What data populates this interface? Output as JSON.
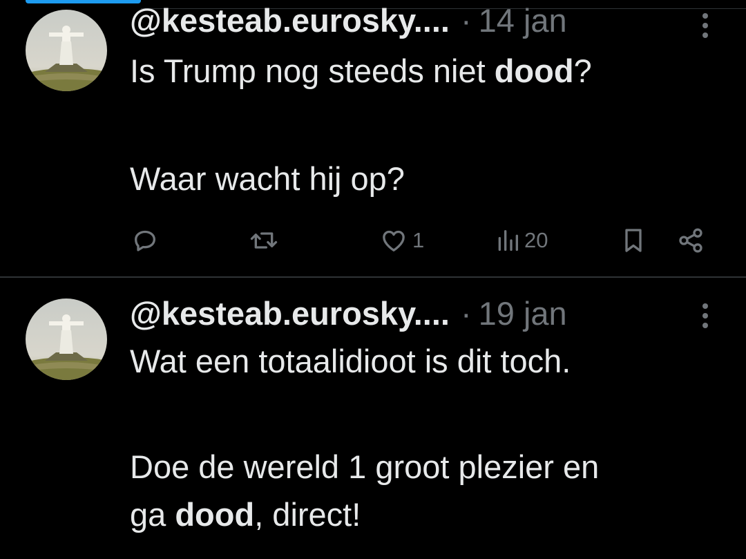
{
  "tweets": [
    {
      "handle": "@kesteab.eurosky....",
      "separator": "·",
      "date": "14 jan",
      "body": {
        "line1_pre": "Is Trump nog steeds niet ",
        "line1_bold": "dood",
        "line1_post": "?",
        "line2": "Waar wacht hij op?"
      },
      "stats": {
        "replies": "",
        "retweets": "",
        "likes": "1",
        "views": "20"
      }
    },
    {
      "handle": "@kesteab.eurosky....",
      "separator": "·",
      "date": "19 jan",
      "body": {
        "line1": "Wat een totaalidioot is dit toch.",
        "line2": "Doe de wereld 1 groot plezier en",
        "line3_pre": "ga ",
        "line3_bold": "dood",
        "line3_post": ", direct!"
      }
    }
  ],
  "icons": {
    "reply": "reply-icon",
    "retweet": "retweet-icon",
    "like": "heart-icon",
    "views": "views-icon",
    "bookmark": "bookmark-icon",
    "share": "share-icon",
    "more": "more-vertical-icon"
  },
  "colors": {
    "background": "#000000",
    "text": "#e7e9ea",
    "muted": "#71767b",
    "divider": "#2f3336",
    "accent": "#1d9bf0"
  }
}
